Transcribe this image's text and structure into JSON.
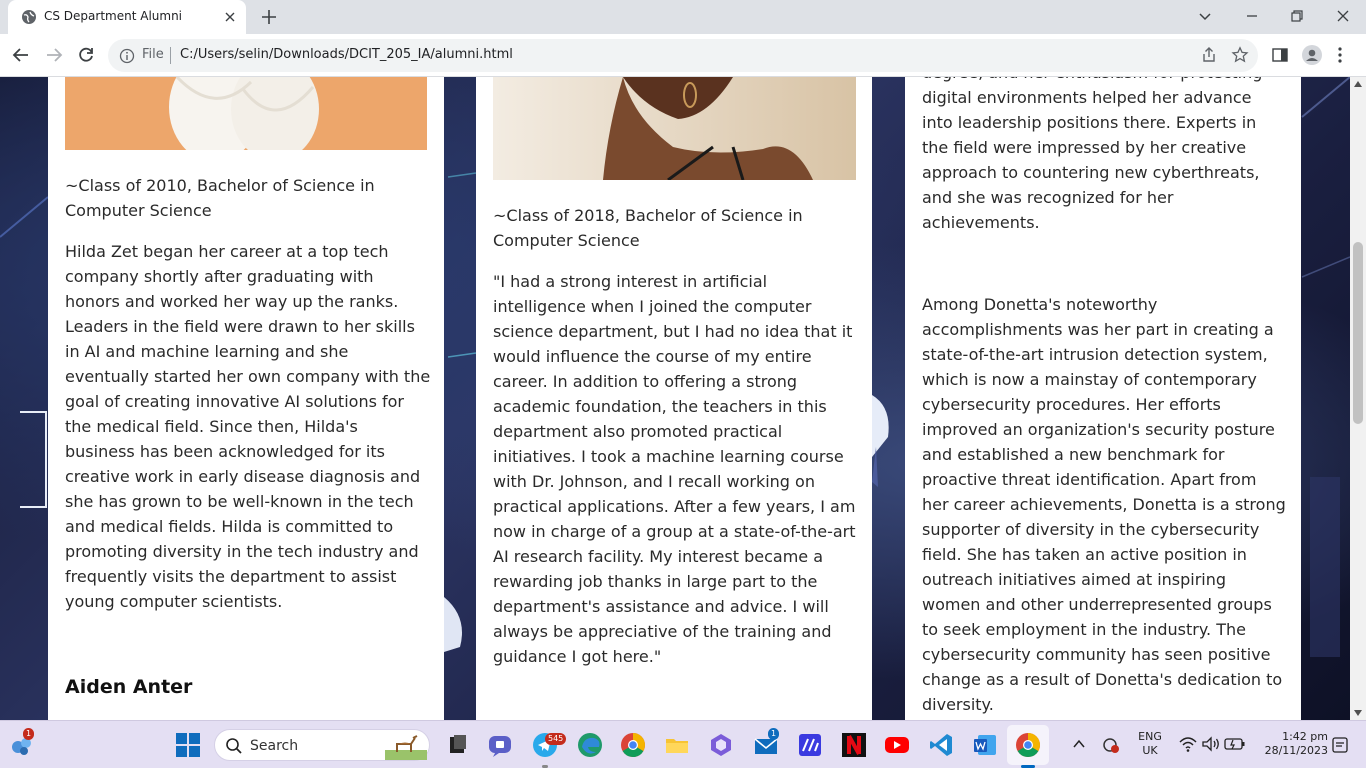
{
  "browser": {
    "tab_title": "CS Department Alumni",
    "scheme_label": "File",
    "url": "C:/Users/selin/Downloads/DCIT_205_IA/alumni.html"
  },
  "page": {
    "col1": {
      "class_line": "~Class of 2010, Bachelor of Science in Computer Science",
      "bio": "Hilda Zet began her career at a top tech company shortly after graduating with honors and worked her way up the ranks. Leaders in the field were drawn to her skills in AI and machine learning and she eventually started her own company with the goal of creating innovative AI solutions for the medical field. Since then, Hilda's business has been acknowledged for its creative work in early disease diagnosis and she has grown to be well-known in the tech and medical fields. Hilda is committed to promoting diversity in the tech industry and frequently visits the department to assist young computer scientists.",
      "next_name": "Aiden Anter"
    },
    "col2": {
      "class_line": "~Class of 2018, Bachelor of Science in Computer Science",
      "quote": "\"I had a strong interest in artificial intelligence when I joined the computer science department, but I had no idea that it would influence the course of my entire career. In addition to offering a strong academic foundation, the teachers in this department also promoted practical initiatives. I took a machine learning course with Dr. Johnson, and I recall working on practical applications. After a few years, I am now in charge of a group at a state-of-the-art AI research facility. My interest became a rewarding job thanks in large part to the department's assistance and advice. I will always be appreciative of the training and guidance I got here.\""
    },
    "col3": {
      "cut_line": "degree, and her enthusiasm for protecting",
      "para1": "digital environments helped her advance into leadership positions there. Experts in the field were impressed by her creative approach to countering new cyberthreats, and she was recognized for her achievements.",
      "para2": "Among Donetta's noteworthy accomplishments was her part in creating a state-of-the-art intrusion detection system, which is now a mainstay of contemporary cybersecurity procedures. Her efforts improved an organization's security posture and established a new benchmark for proactive threat identification. Apart from her career achievements, Donetta is a strong supporter of diversity in the cybersecurity field. She has taken an active position in outreach initiatives aimed at inspiring women and other underrepresented groups to seek employment in the industry. The cybersecurity community has seen positive change as a result of Donetta's dedication to diversity."
    }
  },
  "taskbar": {
    "search_label": "Search",
    "widgets_badge": "1",
    "telegram_badge": "545",
    "mail_badge": "1",
    "lang_top": "ENG",
    "lang_bottom": "UK",
    "time": "1:42 pm",
    "date": "28/11/2023"
  },
  "colors": {
    "accent": "#0067c0",
    "badge_red": "#c42b1c"
  }
}
